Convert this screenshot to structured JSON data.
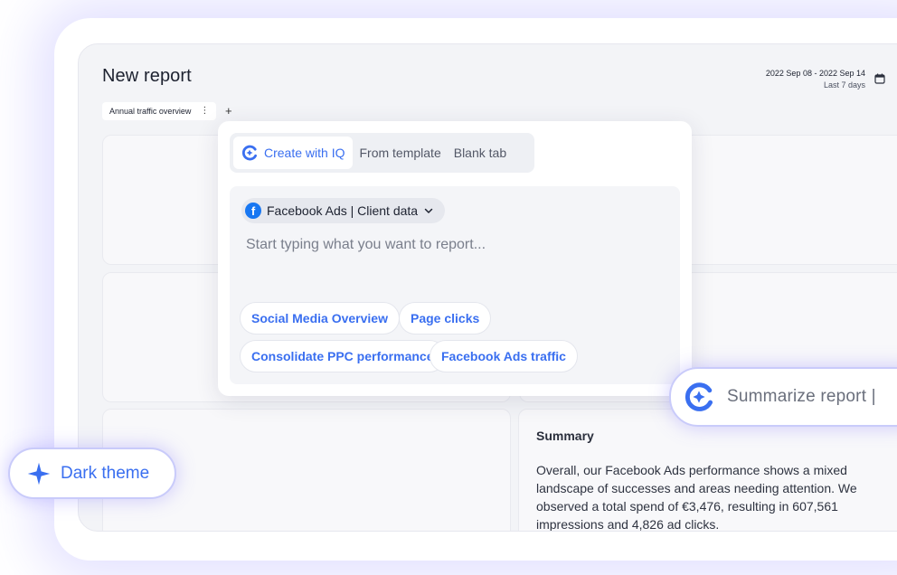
{
  "report": {
    "title": "New report",
    "date_range": "2022 Sep 08 - 2022 Sep 14",
    "date_sub": "Last 7 days",
    "tab_label": "Annual traffic overview",
    "kebab": "⋮",
    "add_tab": "+"
  },
  "iq_panel": {
    "tabs": [
      "Create with IQ",
      "From template",
      "Blank tab"
    ],
    "active_tab": "Create with IQ",
    "data_source": "Facebook Ads | Client data",
    "input_value": "",
    "input_placeholder": "Start typing what you want to report...",
    "suggestions": [
      "Social Media Overview",
      "Page clicks",
      "Consolidate PPC performance",
      "Facebook Ads traffic"
    ]
  },
  "summary": {
    "title": "Summary",
    "body": "Overall, our Facebook Ads performance shows a mixed landscape of successes and areas needing attention. We observed a total spend of €3,476, resulting in 607,561 impressions and 4,826 ad clicks."
  },
  "floating": {
    "summarize": "Summarize report |",
    "dark_theme": "Dark theme"
  },
  "colors": {
    "accent": "#3a6ff0",
    "glow": "#786eff",
    "facebook": "#1877f2"
  },
  "icons": [
    "iq-logo-icon",
    "calendar-icon",
    "facebook-icon",
    "chevron-down-icon",
    "sparkle-icon",
    "kebab-menu-icon",
    "plus-icon"
  ]
}
